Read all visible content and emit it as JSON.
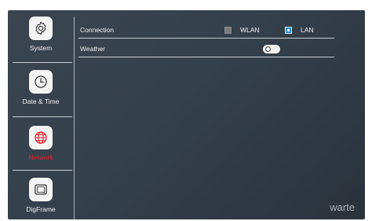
{
  "sidebar": {
    "items": [
      {
        "label": "System",
        "icon": "gear-icon",
        "active": false
      },
      {
        "label": "Date & Time",
        "icon": "clock-icon",
        "active": false
      },
      {
        "label": "Network",
        "icon": "globe-icon",
        "active": true
      },
      {
        "label": "DigFrame",
        "icon": "picture-frame-icon",
        "active": false
      }
    ]
  },
  "settings": {
    "connection": {
      "label": "Connection",
      "options": [
        {
          "label": "WLAN",
          "checked": false
        },
        {
          "label": "LAN",
          "checked": true
        }
      ]
    },
    "weather": {
      "label": "Weather",
      "toggle_on": false
    }
  },
  "brand": "warte",
  "colors": {
    "active_accent": "#e0222a",
    "checkbox_checked": "#2a8fd8",
    "background": "#34404b"
  }
}
